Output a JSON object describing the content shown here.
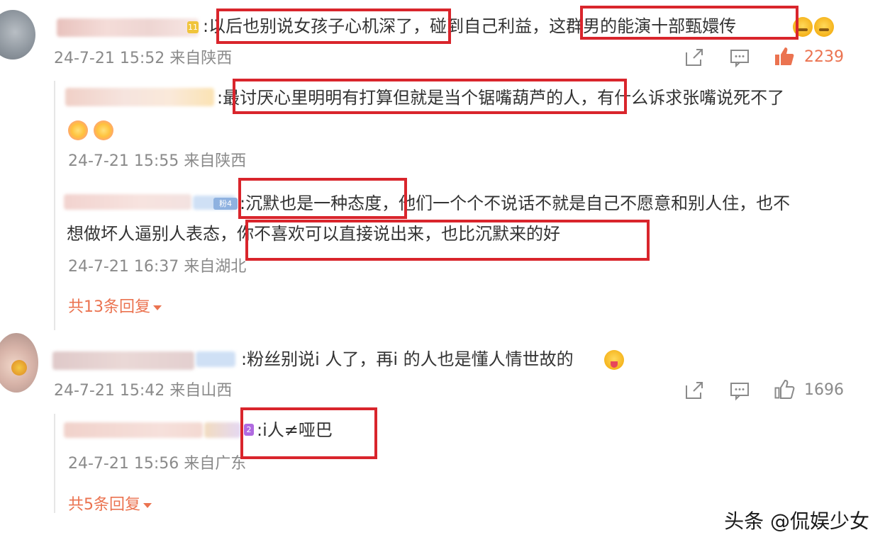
{
  "comments": [
    {
      "badge": "11",
      "text": ":以后也别说女孩子心机深了，碰到自己利益，这群男的能演十部甄嬛传",
      "meta": "24-7-21 15:52 来自陕西",
      "likes": "2239",
      "replies": [
        {
          "text_line1": ":最讨厌心里明明有打算但就是当个锯嘴葫芦的人，有什么诉求张嘴说死不了",
          "meta": "24-7-21 15:55 来自陕西"
        },
        {
          "badge": "粉4",
          "text_line1": ":沉默也是一种态度，他们一个个不说话不就是自己不愿意和别人住，也不",
          "text_line2": "想做坏人逼别人表态，你不喜欢可以直接说出来，也比沉默来的好",
          "meta": "24-7-21 16:37 来自湖北"
        }
      ],
      "more": "共13条回复"
    },
    {
      "text": ":粉丝别说i 人了，再i 的人也是懂人情世故的",
      "meta": "24-7-21 15:42 来自山西",
      "likes": "1696",
      "replies": [
        {
          "badge": "2",
          "text_line1": ":i人≠哑巴",
          "meta": "24-7-21 15:56 来自广东"
        }
      ],
      "more": "共5条回复"
    }
  ],
  "watermark": "头条 @侃娱少女",
  "colors": {
    "highlight_box": "#d9252c",
    "more_link": "#eb7350",
    "liked": "#eb7350",
    "meta_text": "#8a8a8a"
  },
  "icons": [
    "share-icon",
    "comment-icon",
    "like-icon",
    "emoji-crying",
    "emoji-flower",
    "emoji-tongue"
  ]
}
